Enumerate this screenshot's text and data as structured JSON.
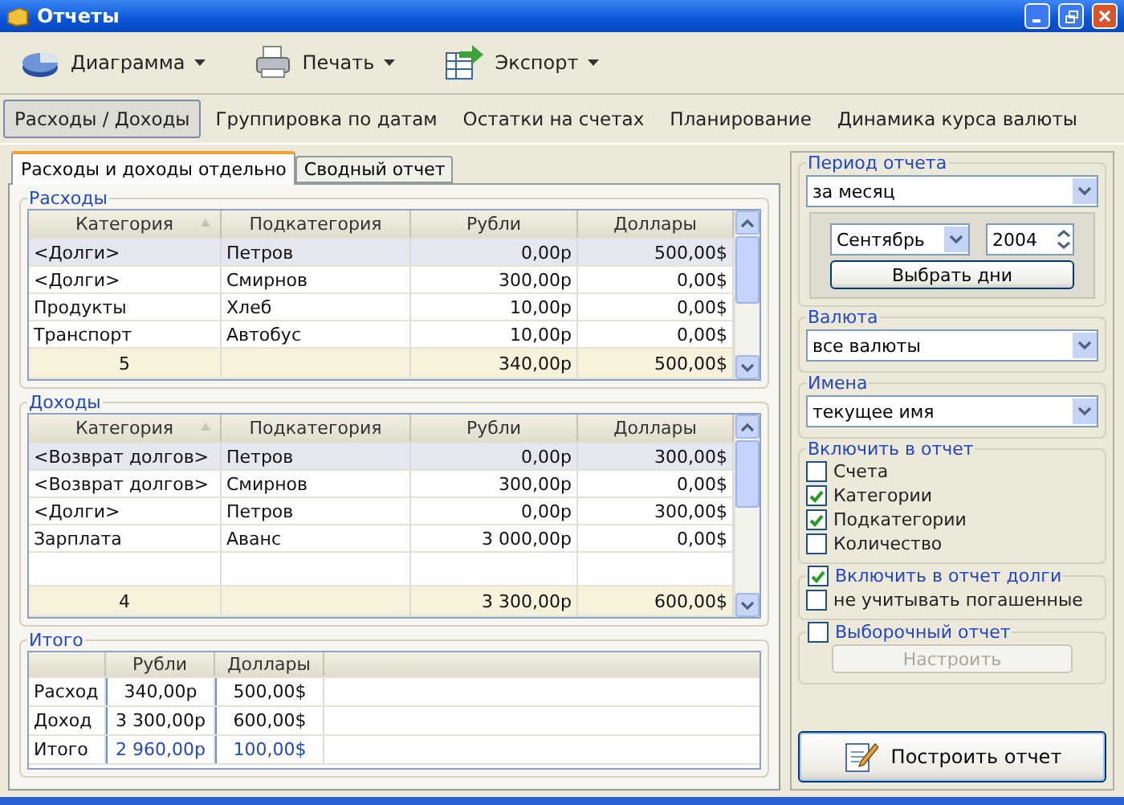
{
  "window": {
    "title": "Отчеты"
  },
  "toolbar": [
    {
      "kind": "chart",
      "label": "Диаграмма"
    },
    {
      "kind": "print",
      "label": "Печать"
    },
    {
      "kind": "export",
      "label": "Экспорт"
    }
  ],
  "nav_tabs": [
    {
      "label": "Расходы / Доходы",
      "selected": true
    },
    {
      "label": "Группировка по датам",
      "selected": false
    },
    {
      "label": "Остатки на счетах",
      "selected": false
    },
    {
      "label": "Планирование",
      "selected": false
    },
    {
      "label": "Динамика курса валюты",
      "selected": false
    }
  ],
  "sub_tabs": [
    {
      "label": "Расходы и доходы отдельно",
      "selected": true
    },
    {
      "label": "Сводный отчет",
      "selected": false
    }
  ],
  "expenses": {
    "title": "Расходы",
    "columns": [
      {
        "label": "Категория",
        "sorted": true
      },
      {
        "label": "Подкатегория",
        "sorted": false
      },
      {
        "label": "Рубли",
        "sorted": false
      },
      {
        "label": "Доллары",
        "sorted": false
      }
    ],
    "rows": [
      {
        "cells": [
          "<Долги>",
          "Петров",
          "0,00р",
          "500,00$"
        ],
        "selected": true
      },
      {
        "cells": [
          "<Долги>",
          "Смирнов",
          "300,00р",
          "0,00$"
        ],
        "selected": false
      },
      {
        "cells": [
          "Продукты",
          "Хлеб",
          "10,00р",
          "0,00$"
        ],
        "selected": false
      },
      {
        "cells": [
          "Транспорт",
          "Автобус",
          "10,00р",
          "0,00$"
        ],
        "selected": false
      }
    ],
    "totals": {
      "count": "5",
      "rubles": "340,00р",
      "dollars": "500,00$"
    }
  },
  "income": {
    "title": "Доходы",
    "columns": [
      {
        "label": "Категория",
        "sorted": true
      },
      {
        "label": "Подкатегория",
        "sorted": false
      },
      {
        "label": "Рубли",
        "sorted": false
      },
      {
        "label": "Доллары",
        "sorted": false
      }
    ],
    "rows": [
      {
        "cells": [
          "<Возврат долгов>",
          "Петров",
          "0,00р",
          "300,00$"
        ],
        "selected": true
      },
      {
        "cells": [
          "<Возврат долгов>",
          "Смирнов",
          "300,00р",
          "0,00$"
        ],
        "selected": false
      },
      {
        "cells": [
          "<Долги>",
          "Петров",
          "0,00р",
          "300,00$"
        ],
        "selected": false
      },
      {
        "cells": [
          "Зарплата",
          "Аванс",
          "3 000,00р",
          "0,00$"
        ],
        "selected": false
      }
    ],
    "totals": {
      "count": "4",
      "rubles": "3 300,00р",
      "dollars": "600,00$"
    }
  },
  "summary": {
    "title": "Итого",
    "columns": [
      "Рубли",
      "Доллары"
    ],
    "rows": [
      {
        "kind": "plain",
        "label": "Расход",
        "values": [
          "340,00р",
          "500,00$"
        ]
      },
      {
        "kind": "plain",
        "label": "Доход",
        "values": [
          "3 300,00р",
          "600,00$"
        ]
      },
      {
        "kind": "total",
        "label": "Итого",
        "values": [
          "2 960,00р",
          "100,00$"
        ]
      }
    ]
  },
  "period": {
    "title": "Период отчета",
    "value": "за месяц",
    "month": "Сентябрь",
    "year": "2004",
    "button": "Выбрать дни"
  },
  "currency": {
    "title": "Валюта",
    "value": "все валюты"
  },
  "names": {
    "title": "Имена",
    "value": "текущее имя"
  },
  "include": {
    "title": "Включить в отчет",
    "options": [
      {
        "label": "Счета",
        "checked": false
      },
      {
        "label": "Категории",
        "checked": true
      },
      {
        "label": "Подкатегории",
        "checked": true
      },
      {
        "label": "Количество",
        "checked": false
      }
    ]
  },
  "debts": {
    "label": "Включить в отчет долги",
    "checked": true,
    "options": [
      {
        "label": "не учитывать погашенные",
        "checked": false
      }
    ]
  },
  "custom": {
    "label": "Выборочный отчет",
    "checked": false,
    "button": "Настроить",
    "button_disabled": true
  },
  "build_button": "Построить отчет"
}
